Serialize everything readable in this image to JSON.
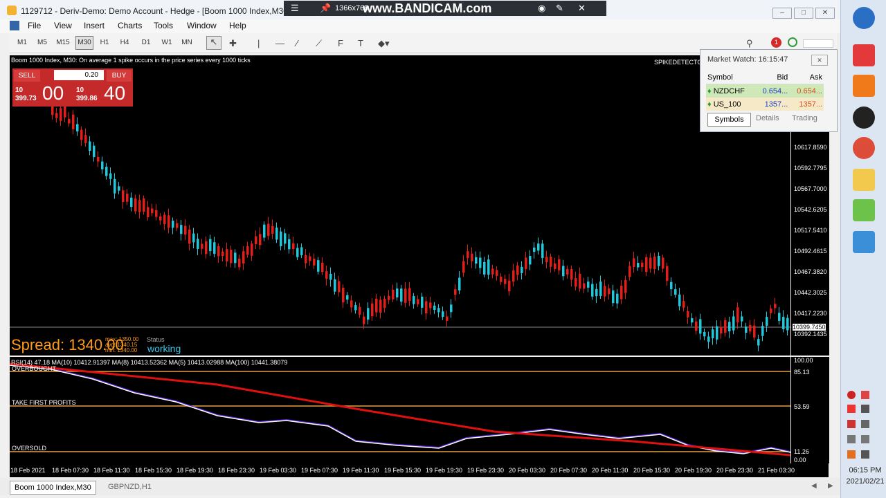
{
  "window": {
    "title": "1129712 - Deriv-Demo: Demo Account - Hedge - [Boom 1000 Index,M30]"
  },
  "bandicam": {
    "resolution": "1366x768",
    "brand": "www.BANDICAM.com"
  },
  "menu": [
    "File",
    "Insert",
    "Charts",
    "Tools",
    "Window",
    "Help"
  ],
  "menu_view": "View",
  "timeframes": [
    "M1",
    "M5",
    "M15",
    "M30",
    "H1",
    "H4",
    "D1",
    "W1",
    "MN"
  ],
  "active_timeframe": "M30",
  "chart": {
    "symbol_line": "Boom 1000 Index, M30:  On average 1 spike occurs in the price series every 1000 ticks",
    "indicator_label": "SPIKEDETECTO",
    "price_ticks": [
      "10617.8590",
      "10592.7795",
      "10567.7000",
      "10542.6205",
      "10517.5410",
      "10492.4615",
      "10467.3820",
      "10442.3025",
      "10417.2230",
      "10392.1435"
    ],
    "current_price": "10399.7450",
    "time_ticks": [
      "18 Feb 2021",
      "18 Feb 07:30",
      "18 Feb 11:30",
      "18 Feb 15:30",
      "18 Feb 19:30",
      "18 Feb 23:30",
      "19 Feb 03:30",
      "19 Feb 07:30",
      "19 Feb 11:30",
      "19 Feb 15:30",
      "19 Feb 19:30",
      "19 Feb 23:30",
      "20 Feb 03:30",
      "20 Feb 07:30",
      "20 Feb 11:30",
      "20 Feb 15:30",
      "20 Feb 19:30",
      "20 Feb 23:30",
      "21 Feb 03:30"
    ]
  },
  "trade_panel": {
    "sell_label": "SELL",
    "buy_label": "BUY",
    "lot": "0.20",
    "sell_small": "10",
    "sell_mid": "399.73",
    "sell_big": "00",
    "buy_small": "10",
    "buy_mid": "399.86",
    "buy_big": "40"
  },
  "spread": {
    "label": "Spread: 1340.00",
    "max": "max: 1350.00",
    "avg": "avg: 1340.15",
    "min": "min: 1340.00",
    "status_label": "Status",
    "status": "working"
  },
  "rsi": {
    "header": "RSI(14) 47.18 MA(10) 10412.91397 MA(8) 10413.52362 MA(5) 10413.02988 MA(100) 10441.38079",
    "levels": [
      "100.00",
      "85.13",
      "53.59",
      "11.26",
      "0.00"
    ],
    "overbought_label": "OVERBOUGHT",
    "take_profit_label": "TAKE FIRST PROFITS",
    "oversold_label": "OVERSOLD"
  },
  "market_watch": {
    "title": "Market Watch: 16:15:47",
    "columns": [
      "Symbol",
      "Bid",
      "Ask"
    ],
    "rows": [
      {
        "symbol": "NZDCHF",
        "bid": "0.654...",
        "ask": "0.654..."
      },
      {
        "symbol": "US_100",
        "bid": "1357...",
        "ask": "1357..."
      }
    ],
    "tabs": [
      "Symbols",
      "Details",
      "Trading"
    ]
  },
  "chart_tabs": [
    "Boom 1000 Index,M30",
    "GBPNZD,H1"
  ],
  "clock": {
    "time": "06:15 PM",
    "date": "2021/02/21"
  },
  "notification_count": "1",
  "colors": {
    "bull": "#26c6da",
    "bear": "#e0201b",
    "rsi_ma": "#e01010",
    "level": "#e8a040"
  }
}
